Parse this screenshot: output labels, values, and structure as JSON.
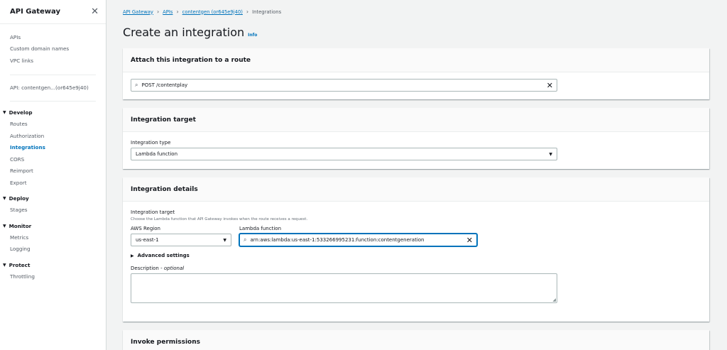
{
  "sidebar": {
    "title": "API Gateway",
    "links_top": [
      "APIs",
      "Custom domain names",
      "VPC links"
    ],
    "api_name": "API: contentgen...(or645e9j40)",
    "sections": [
      {
        "label": "Develop",
        "items": [
          "Routes",
          "Authorization",
          "Integrations",
          "CORS",
          "Reimport",
          "Export"
        ]
      },
      {
        "label": "Deploy",
        "items": [
          "Stages"
        ]
      },
      {
        "label": "Monitor",
        "items": [
          "Metrics",
          "Logging"
        ]
      },
      {
        "label": "Protect",
        "items": [
          "Throttling"
        ]
      }
    ],
    "active_item": "Integrations"
  },
  "breadcrumb": {
    "items": [
      "API Gateway",
      "APIs",
      "contentgen (or645e9j40)"
    ],
    "current": "Integrations"
  },
  "page": {
    "title": "Create an integration",
    "info": "Info"
  },
  "route_panel": {
    "title": "Attach this integration to a route",
    "route_value": "POST /contentplay"
  },
  "target_panel": {
    "title": "Integration target",
    "type_label": "Integration type",
    "type_value": "Lambda function"
  },
  "details_panel": {
    "title": "Integration details",
    "target_label": "Integration target",
    "target_description": "Choose the Lambda function that API Gateway invokes when the route receives a request.",
    "region_label": "AWS Region",
    "region_value": "us-east-1",
    "lambda_label": "Lambda function",
    "lambda_value": "arn:aws:lambda:us-east-1:533266995231:function:contentgeneration",
    "advanced_label": "Advanced settings",
    "description_label": "Description",
    "description_optional": "optional",
    "description_value": ""
  },
  "permissions_panel": {
    "title": "Invoke permissions"
  },
  "colors": {
    "link": "#0073bb",
    "background": "#f2f3f3",
    "panel": "#ffffff"
  }
}
